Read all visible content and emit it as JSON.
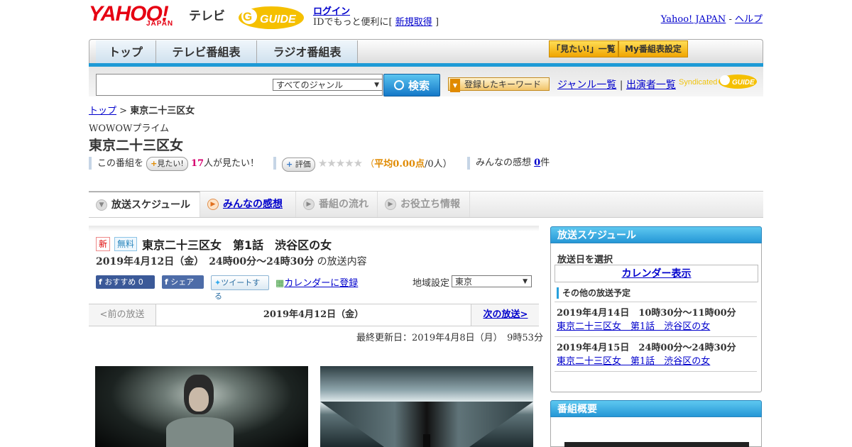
{
  "header": {
    "logo_yahoo": "YAHOO!",
    "logo_japan": "JAPAN",
    "logo_tv": "テレビ",
    "logo_gguide": "GUIDE",
    "login": "ログイン",
    "login_sub_pre": "IDでもっと便利に[",
    "login_sub_link": "新規取得",
    "login_sub_post": "]",
    "link_yahoo": "Yahoo! JAPAN",
    "link_sep": " - ",
    "link_help": "ヘルプ"
  },
  "nav": {
    "tabs": [
      "トップ",
      "テレビ番組表",
      "ラジオ番組表"
    ],
    "wanted_list": "「見たい!」一覧",
    "my_guide": "My番組表設定"
  },
  "search": {
    "genre_selected": "すべてのジャンル",
    "button": "検索",
    "keyword_button": "登録したキーワード",
    "genre_list": "ジャンル一覧",
    "divider": "|",
    "cast_list": "出演者一覧",
    "syndicated": "Syndicated"
  },
  "breadcrumb": {
    "top": "トップ",
    "sep": " > ",
    "current": "東京二十三区女"
  },
  "program": {
    "channel": "WOWOWプライム",
    "title": "東京二十三区女",
    "this_program": "この番組を",
    "want_button": "見たい!",
    "want_count": "17",
    "want_suffix": "人が見たい！",
    "rate_button": "評価",
    "rating_pre": "（",
    "rating_avg": "平均0.00点",
    "rating_post": "/0人）",
    "reviews_label": "みんなの感想",
    "reviews_count": "0",
    "reviews_suffix": "件"
  },
  "tabs": [
    {
      "label": "放送スケジュール"
    },
    {
      "label": "みんなの感想"
    },
    {
      "label": "番組の流れ"
    },
    {
      "label": "お役立ち情報"
    }
  ],
  "episode": {
    "badge_new": "新",
    "badge_free": "無料",
    "title": "東京二十三区女　第1話　渋谷区の女",
    "datetime": "2019年4月12日（金）　24時00分～24時30分",
    "datetime_suffix": "の放送内容",
    "recommend": "おすすめ 0",
    "share": "シェア",
    "tweet": "ツイートする",
    "calendar_register": "カレンダーに登録",
    "region_label": "地域設定",
    "region_value": "東京",
    "prev": "<前の放送",
    "current_date": "2019年4月12日（金）",
    "next": "次の放送>",
    "updated": "最終更新日：2019年4月8日（月）　9時53分"
  },
  "sidebar": {
    "schedule_title": "放送スケジュール",
    "select_date": "放送日を選択",
    "calendar_button": "カレンダー表示",
    "other_title": "その他の放送予定",
    "other": [
      {
        "datetime": "2019年4月14日　10時30分～11時00分",
        "title": "東京二十三区女　第1話　渋谷区の女"
      },
      {
        "datetime": "2019年4月15日　24時00分～24時30分",
        "title": "東京二十三区女　第1話　渋谷区の女"
      }
    ],
    "overview_title": "番組概要"
  },
  "colors": {
    "accent_blue": "#1e9ad6",
    "brand_red": "#e60012",
    "want_pink": "#d6006f",
    "rating_orange": "#e08a00"
  },
  "icons": [
    "gguide-logo",
    "search-icon",
    "star-icon",
    "facebook-icon",
    "twitter-icon",
    "calendar-icon",
    "play-circle-icon"
  ]
}
